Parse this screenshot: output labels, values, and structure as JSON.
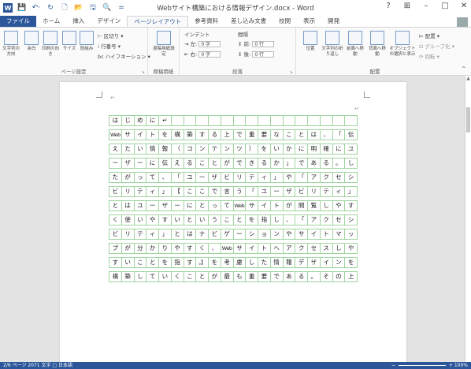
{
  "window": {
    "title": "Webサイト構築における情報デザイン.docx - Word",
    "help": "?",
    "ribbon_display": "⊞",
    "minimize": "–",
    "maximize": "□",
    "close": "✕"
  },
  "qat": {
    "logo": "W",
    "save": "💾",
    "undo": "↶·",
    "redo": "↻",
    "new": "🗋",
    "open": "📂",
    "print": "🖫",
    "preview": "🔍",
    "more": "="
  },
  "tabs": [
    "ファイル",
    "ホーム",
    "挿入",
    "デザイン",
    "ページレイアウト",
    "参考資料",
    "差し込み文書",
    "校閲",
    "表示",
    "開発"
  ],
  "active_tab_index": 4,
  "ribbon": {
    "page_setup": {
      "label": "ページ設定",
      "text_direction": "文字列の方向",
      "margins": "余白",
      "orientation": "印刷の向き",
      "size": "サイズ",
      "columns": "段組み",
      "breaks": "区切り",
      "line_numbers": "行番号",
      "hyphenation": "ハイフネーション"
    },
    "manuscript": {
      "label": "原稿用紙",
      "button": "原稿用紙設定"
    },
    "paragraph": {
      "label": "段落",
      "indent_header": "インデント",
      "spacing_header": "間隔",
      "left_label": "左:",
      "left_value": "0 字",
      "right_label": "右:",
      "right_value": "0 字",
      "before_label": "前:",
      "before_value": "0 行",
      "after_label": "後:",
      "after_value": "0 行"
    },
    "arrange": {
      "label": "配置",
      "position": "位置",
      "wrap_text": "文字列の折り返し",
      "bring_forward": "前面へ移動",
      "send_backward": "背面へ移動",
      "selection_pane": "オブジェクトの選択と表示",
      "align": "配置",
      "group": "グループ化",
      "rotate": "回転"
    }
  },
  "document": {
    "rows": [
      [
        "は",
        "じ",
        "め",
        "に",
        "↵",
        "",
        "",
        "",
        "",
        "",
        "",
        "",
        "",
        "",
        "",
        "",
        "",
        "",
        "",
        ""
      ],
      [
        "Web",
        "サ",
        "イ",
        "ト",
        "を",
        "構",
        "築",
        "す",
        "る",
        "上",
        "で",
        "重",
        "要",
        "な",
        "こ",
        "と",
        "は",
        "、",
        "「",
        "伝"
      ],
      [
        "え",
        "た",
        "い",
        "情",
        "報",
        "（",
        "コ",
        "ン",
        "テ",
        "ン",
        "ツ",
        "）",
        "を",
        "い",
        "か",
        "に",
        "明",
        "確",
        "に",
        "ユ"
      ],
      [
        "ー",
        "ザ",
        "ー",
        "に",
        "伝",
        "え",
        "る",
        "こ",
        "と",
        "が",
        "で",
        "き",
        "る",
        "か",
        "」",
        "で",
        "あ",
        "る",
        "。",
        "し"
      ],
      [
        "た",
        "が",
        "っ",
        "て",
        "、",
        "「",
        "ユ",
        "ー",
        "ザ",
        "ビ",
        "リ",
        "テ",
        "ィ",
        "」",
        "や",
        "「",
        "ア",
        "ク",
        "セ",
        "シ"
      ],
      [
        "ビ",
        "リ",
        "テ",
        "ィ",
        "」",
        "【",
        "こ",
        "こ",
        "で",
        "言",
        "う",
        "「",
        "ユ",
        "ー",
        "ザ",
        "ビ",
        "リ",
        "テ",
        "ィ",
        "」"
      ],
      [
        "と",
        "は",
        "ユ",
        "ー",
        "ザ",
        "ー",
        "に",
        "と",
        "っ",
        "て",
        "Web",
        "サ",
        "イ",
        "ト",
        "が",
        "閲",
        "覧",
        "し",
        "や",
        "す"
      ],
      [
        "く",
        "使",
        "い",
        "や",
        "す",
        "い",
        "と",
        "い",
        "う",
        "こ",
        "と",
        "を",
        "指",
        "し",
        "、",
        "「",
        "ア",
        "ク",
        "セ",
        "シ"
      ],
      [
        "ビ",
        "リ",
        "テ",
        "ィ",
        "」",
        "と",
        "は",
        "ナ",
        "ビ",
        "ゲ",
        "ー",
        "シ",
        "ョ",
        "ン",
        "や",
        "サ",
        "イ",
        "ト",
        "マ",
        "ッ"
      ],
      [
        "プ",
        "が",
        "分",
        "か",
        "り",
        "や",
        "す",
        "く",
        "、",
        "Web",
        "サ",
        "イ",
        "ト",
        "へ",
        "ア",
        "ク",
        "セ",
        "ス",
        "し",
        "や"
      ],
      [
        "す",
        "い",
        "こ",
        "と",
        "を",
        "指",
        "す",
        "。】",
        "を",
        "考",
        "慮",
        "し",
        "た",
        "情",
        "報",
        "デ",
        "ザ",
        "イ",
        "ン",
        "を"
      ],
      [
        "構",
        "築",
        "し",
        "て",
        "い",
        "く",
        "こ",
        "と",
        "が",
        "最",
        "も",
        "重",
        "要",
        "で",
        "あ",
        "る",
        "。",
        "そ",
        "の",
        "上"
      ]
    ]
  },
  "status": {
    "left": "2/6 ページ  2071 文字  □  日本語",
    "right": "100%"
  }
}
